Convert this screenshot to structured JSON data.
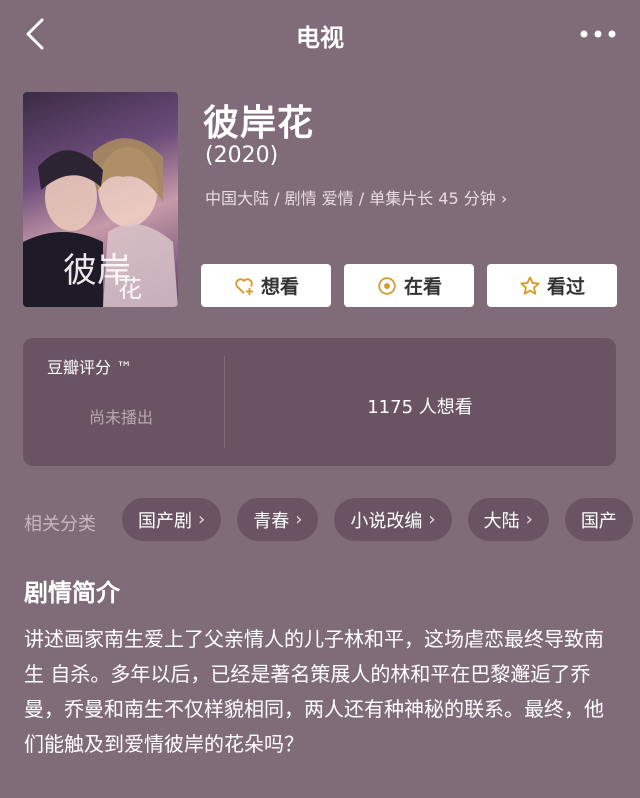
{
  "header": {
    "title": "电视",
    "back_icon": "chevron-left-icon",
    "more_icon": "more-dots-icon"
  },
  "movie": {
    "title": "彼岸花",
    "year": "(2020)",
    "meta": "中国大陆 / 剧情 爱情 / 单集片长 45 分钟 ›"
  },
  "actions": [
    {
      "label": "想看",
      "icon": "heart-plus-icon"
    },
    {
      "label": "在看",
      "icon": "circle-dot-icon"
    },
    {
      "label": "看过",
      "icon": "star-icon"
    }
  ],
  "rating": {
    "label": "豆瓣评分 ™",
    "status": "尚未播出",
    "want_count": "1175 人想看"
  },
  "related": {
    "label": "相关分类",
    "chips": [
      "国产剧",
      "青春",
      "小说改编",
      "大陆",
      "国产"
    ]
  },
  "synopsis": {
    "title": "剧情简介",
    "text": "讲述画家南生爱上了父亲情人的儿子林和平，这场虐恋最终导致南生 自杀。多年以后，已经是著名策展人的林和平在巴黎邂逅了乔曼，乔曼和南生不仅样貌相同，两人还有种神秘的联系。最终，他们能触及到爱情彼岸的花朵吗？"
  },
  "colors": {
    "background": "#806b78",
    "card": "#6a5463",
    "accent": "#d89a2a"
  }
}
